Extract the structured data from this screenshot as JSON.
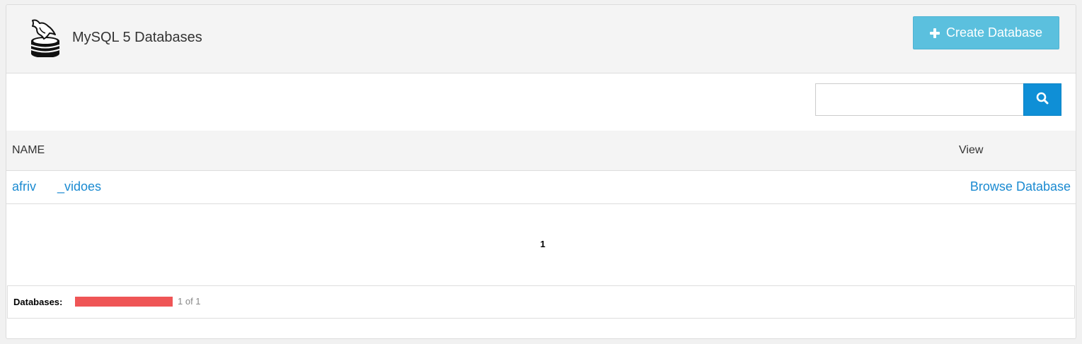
{
  "header": {
    "logo_icon": "mysql-dolphin-database-icon",
    "title": "MySQL 5 Databases",
    "create_button": {
      "icon": "plus-icon",
      "label": "Create Database",
      "color": "#5bc0de"
    }
  },
  "search": {
    "value": "",
    "placeholder": "",
    "button_icon": "search-icon",
    "button_color": "#0f8fd6"
  },
  "table": {
    "columns": [
      "NAME",
      "View"
    ],
    "rows": [
      {
        "name": "afriv      _vidoes",
        "view_label": "Browse Database"
      }
    ]
  },
  "pagination": {
    "current_page": "1"
  },
  "footer": {
    "label": "Databases:",
    "usage_fraction": 1.0,
    "usage_color": "#ef5556",
    "count_text": "1 of 1"
  }
}
